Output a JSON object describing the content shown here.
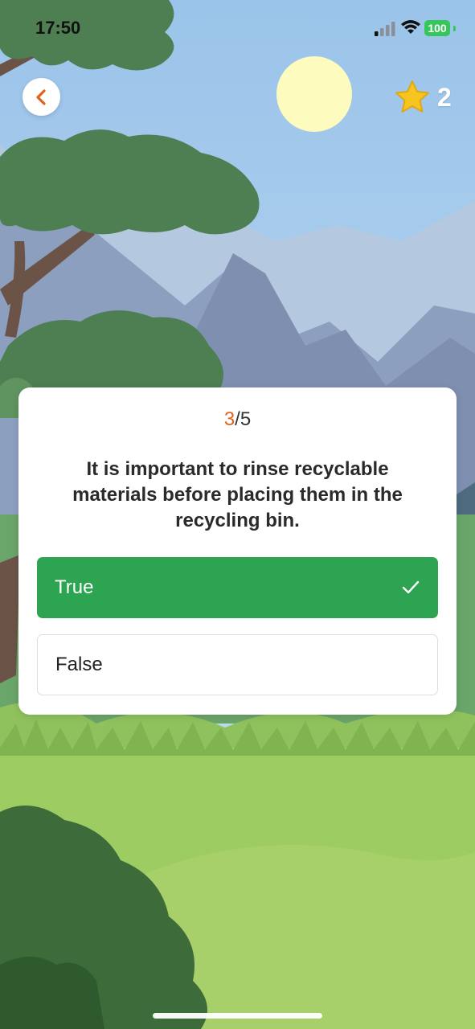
{
  "status_bar": {
    "time": "17:50",
    "battery": "100"
  },
  "header": {
    "score": "2",
    "back_icon": "chevron-left-icon",
    "score_icon": "star-icon"
  },
  "quiz": {
    "progress_current": "3",
    "progress_total": "/5",
    "question": "It is important to rinse recyclable materials before placing them in the recycling bin.",
    "options": [
      {
        "label": "True",
        "state": "correct",
        "icon": "checkmark-icon"
      },
      {
        "label": "False",
        "state": "default"
      }
    ]
  },
  "colors": {
    "accent": "#e2621b",
    "correct": "#2ca451",
    "star": "#f7c520",
    "battery": "#35c759"
  }
}
